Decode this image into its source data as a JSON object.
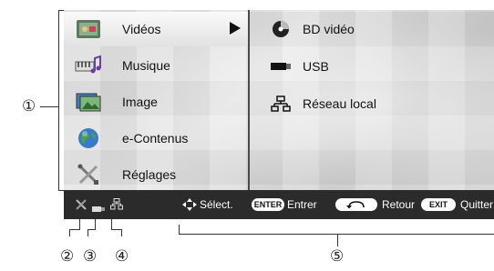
{
  "menu": {
    "items": [
      {
        "label": "Vidéos",
        "icon": "video-icon",
        "selected": true
      },
      {
        "label": "Musique",
        "icon": "music-icon"
      },
      {
        "label": "Image",
        "icon": "image-icon"
      },
      {
        "label": "e-Contenus",
        "icon": "globe-icon"
      },
      {
        "label": "Réglages",
        "icon": "settings-icon"
      }
    ]
  },
  "submenu": {
    "items": [
      {
        "label": "BD vidéo",
        "icon": "disc-icon"
      },
      {
        "label": "USB",
        "icon": "usb-icon"
      },
      {
        "label": "Réseau local",
        "icon": "network-icon"
      }
    ]
  },
  "bottom_bar": {
    "select_label": "Sélect.",
    "enter_key": "ENTER",
    "enter_label": "Entrer",
    "return_label": "Retour",
    "exit_key": "EXIT",
    "exit_label": "Quitter"
  },
  "callouts": [
    "①",
    "②",
    "③",
    "④",
    "⑤"
  ]
}
